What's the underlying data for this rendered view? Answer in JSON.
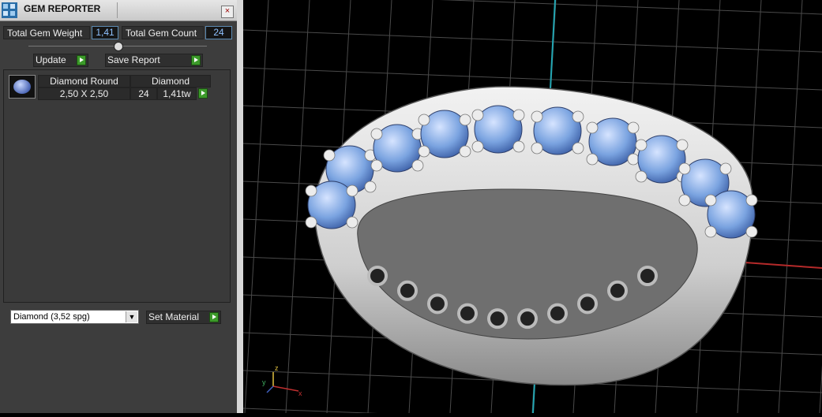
{
  "panel": {
    "title": "GEM REPORTER",
    "close_glyph": "×",
    "total_weight_label": "Total Gem Weight",
    "total_weight_value": "1,41",
    "total_count_label": "Total Gem Count",
    "total_count_value": "24",
    "update_label": "Update",
    "save_report_label": "Save Report",
    "gems": [
      {
        "shape": "Diamond Round",
        "type": "Diamond",
        "size": "2,50 X 2,50",
        "count": "24",
        "weight": "1,41tw"
      }
    ],
    "material_selected": "Diamond     (3,52 spg)",
    "set_material_label": "Set Material"
  },
  "viewport": {
    "axis_labels": [
      "z",
      "y",
      "x"
    ],
    "colors": {
      "background": "#000000",
      "grid": "#4a4a4a",
      "metal": "#d9d9d9",
      "gem": "#7aa3e0"
    }
  }
}
